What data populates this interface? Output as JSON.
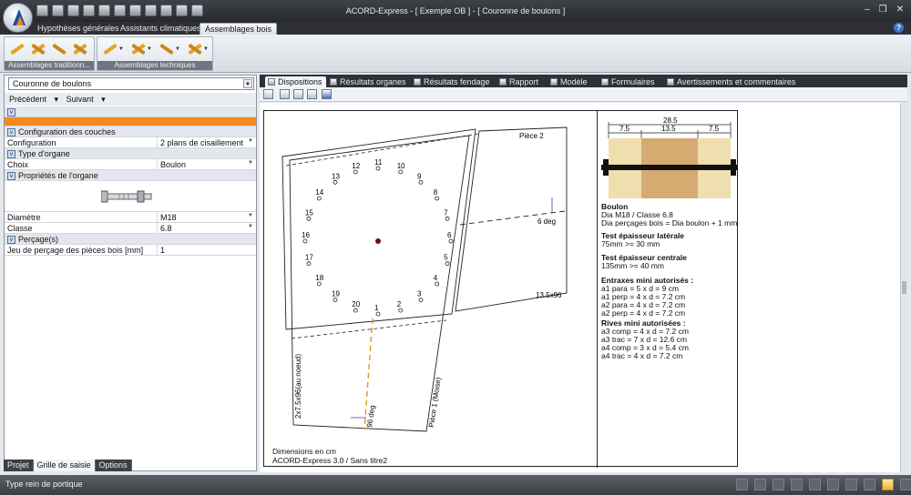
{
  "window": {
    "title": "ACORD-Express - [ Exemple OB ] - [ Couronne de boulons ]"
  },
  "ribbon": {
    "tabs": [
      "Hypothèses générales",
      "Assistants climatiques",
      "Assemblages bois"
    ],
    "active_tab": "Assemblages bois",
    "groups": [
      "Assemblages traditionn...",
      "Assemblages techniques"
    ]
  },
  "left_panel": {
    "organ_selector": "Couronne de boulons",
    "nav": {
      "prev": "Précédent",
      "next": "Suivant"
    },
    "categories": {
      "couches": "Configuration des couches",
      "type": "Type d'organe",
      "props": "Propriétés de l'organe",
      "percage": "Perçage(s)"
    },
    "rows": {
      "configuration": {
        "label": "Configuration",
        "value": "2 plans de cisaillement"
      },
      "choix": {
        "label": "Choix",
        "value": "Boulon"
      },
      "diametre": {
        "label": "Diamètre",
        "value": "M18"
      },
      "classe": {
        "label": "Classe",
        "value": "6.8"
      },
      "jeu": {
        "label": "Jeu de perçage des pièces bois  [mm]",
        "value": "1"
      }
    },
    "tabs": [
      "Projet",
      "Grille de saisie",
      "Options"
    ],
    "active_tab": "Grille de saisie"
  },
  "doc_tabs": [
    "Dispositions",
    "Résultats organes",
    "Résultats fendage",
    "Rapport",
    "Modèle",
    "Formulaires",
    "Avertissements et commentaires"
  ],
  "drawing": {
    "piece2": "Pièce 2",
    "piece1": "Pièce 1 (Moise)",
    "left_section": "2x7.5x96(au noeud)",
    "section2": "13.5x96",
    "angle1": "6 deg",
    "angle2": "96 deg",
    "bolt_numbers": [
      "1",
      "2",
      "3",
      "4",
      "5",
      "6",
      "7",
      "8",
      "9",
      "10",
      "11",
      "12",
      "13",
      "14",
      "15",
      "16",
      "17",
      "18",
      "19",
      "20"
    ],
    "dims_total": "28.5",
    "dims_parts": [
      "7.5",
      "13.5",
      "7.5"
    ],
    "footer1": "Dimensions en cm",
    "footer2": "ACORD-Express 3.0 / Sans titre2"
  },
  "info": {
    "boulon_title": "Boulon",
    "boulon_lines": [
      "Dia M18 / Classe 6.8",
      "Dia perçages bois = Dia boulon + 1 mm"
    ],
    "lat_title": "Test épaisseur latérale",
    "lat_line": "75mm >= 30 mm",
    "cen_title": "Test épaisseur centrale",
    "cen_line": "135mm >= 40 mm",
    "entraxes_title": "Entraxes mini autorisés :",
    "entraxes_lines": [
      "a1 para = 5 x d = 9 cm",
      "a1 perp = 4 x d = 7.2 cm",
      "a2 para = 4 x d = 7.2 cm",
      "a2 perp = 4 x d = 7.2 cm"
    ],
    "rives_title": "Rives mini autorisées :",
    "rives_lines": [
      "a3 comp = 4 x d = 7.2 cm",
      "a3 trac = 7 x d = 12.6 cm",
      "a4 comp = 3 x d = 5.4 cm",
      "a4 trac = 4 x d = 7.2 cm"
    ]
  },
  "status": {
    "text": "Type rein de portique"
  }
}
